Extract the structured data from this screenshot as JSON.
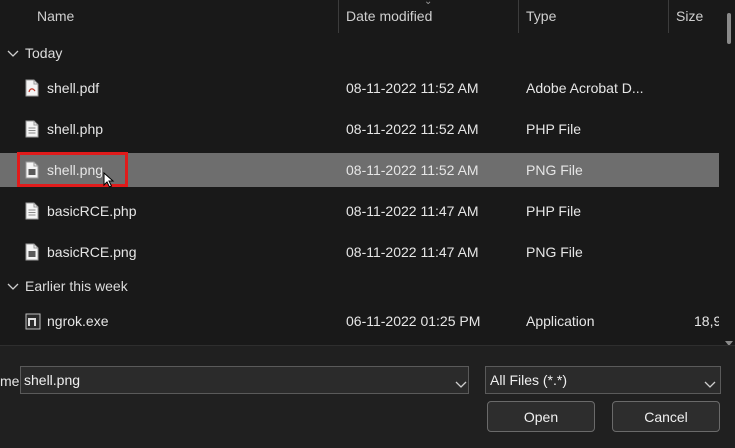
{
  "columns": {
    "name": "Name",
    "date_modified": "Date modified",
    "type": "Type",
    "size": "Size"
  },
  "groups": [
    {
      "label": "Today",
      "files": [
        {
          "name": "shell.pdf",
          "date": "08-11-2022 11:52 AM",
          "type": "Adobe Acrobat D...",
          "size": "",
          "icon": "pdf-file-icon"
        },
        {
          "name": "shell.php",
          "date": "08-11-2022 11:52 AM",
          "type": "PHP File",
          "size": "",
          "icon": "text-file-icon"
        },
        {
          "name": "shell.png",
          "date": "08-11-2022 11:52 AM",
          "type": "PNG File",
          "size": "",
          "icon": "image-file-icon",
          "selected": true
        },
        {
          "name": "basicRCE.php",
          "date": "08-11-2022 11:47 AM",
          "type": "PHP File",
          "size": "",
          "icon": "text-file-icon"
        },
        {
          "name": "basicRCE.png",
          "date": "08-11-2022 11:47 AM",
          "type": "PNG File",
          "size": "",
          "icon": "image-file-icon"
        }
      ]
    },
    {
      "label": "Earlier this week",
      "files": [
        {
          "name": "ngrok.exe",
          "date": "06-11-2022 01:25 PM",
          "type": "Application",
          "size": "18,9",
          "icon": "application-file-icon"
        }
      ]
    }
  ],
  "footer": {
    "filename_label": "me:",
    "filename_value": "shell.png",
    "filetype_value": "All Files (*.*)",
    "open_label": "Open",
    "cancel_label": "Cancel"
  },
  "colors": {
    "background": "#191919",
    "selected_row": "#6e6e6e",
    "highlight_box": "#e01b1b",
    "panel": "#202020"
  }
}
